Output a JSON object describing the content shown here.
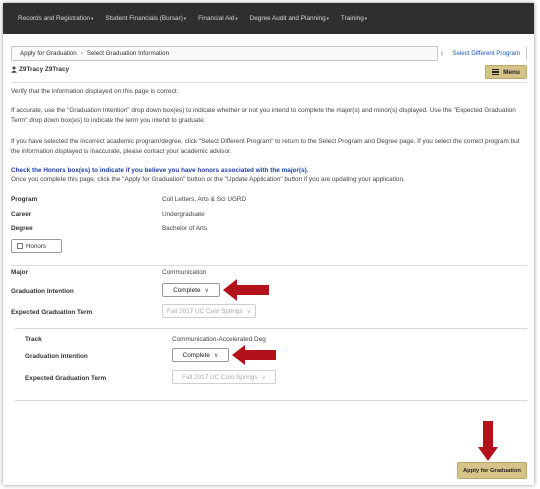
{
  "nav": {
    "items": [
      {
        "label": "Records and Registration"
      },
      {
        "label": "Student Financials (Bursar)"
      },
      {
        "label": "Financial Aid"
      },
      {
        "label": "Degree Audit and Planning"
      },
      {
        "label": "Training"
      }
    ]
  },
  "breadcrumb": {
    "apply": "Apply for Graduation",
    "separator": "›",
    "current": "Select Graduation Information",
    "select_different": "Select Different Program"
  },
  "user": {
    "name": "Z9Tracy Z9Tracy"
  },
  "menu_label": "Menu",
  "instructions": {
    "p1": "Verify that the information displayed on this page is correct.",
    "p2": "If accurate, use the \"Graduation Intention\" drop down box(es) to indicate whether or not you intend to complete the major(s) and minor(s) displayed. Use the \"Expected Graduation Term\" drop down box(es) to indicate the term you intend to graduate.",
    "p3": "If you have selected the incorrect academic program/degree, click \"Select Different Program\" to return to the Select Program and Degree page. If you select the correct program but the information displayed is inaccurate, please contact your academic advisor.",
    "honors_note": "Check the Honors box(es) to indicate if you believe you have honors associated with the major(s).",
    "p4": "Once you complete this page, click the \"Apply for Graduation\" button or the \"Update Application\" button if you are updating your application."
  },
  "program": {
    "program_label": "Program",
    "program_value": "Coll Letters, Arts & Sci UGRD",
    "career_label": "Career",
    "career_value": "Undergraduate",
    "degree_label": "Degree",
    "degree_value": "Bachelor of Arts",
    "honors_label": "Honors"
  },
  "major": {
    "major_label": "Major",
    "major_value": "Communication",
    "intention_label": "Graduation Intention",
    "intention_value": "Complete",
    "term_label": "Expected Graduation Term",
    "term_value": "Fall 2017 UC Colo Springs"
  },
  "track": {
    "track_label": "Track",
    "track_value": "Communication-Accelerated Deg",
    "intention_label": "Graduation Intention",
    "intention_value": "Complete",
    "term_label": "Expected Graduation Term",
    "term_value": "Fall 2017 UC Colo Springs"
  },
  "apply_button": "Apply for Graduation",
  "colors": {
    "nav_bg": "#2f2f2f",
    "button_gold": "#d6c387",
    "arrow_red": "#b3121b",
    "link_blue": "#1a56b4"
  },
  "icons": [
    "person-icon",
    "hamburger-icon",
    "chevron-left-icon",
    "chevron-down-icon",
    "red-arrow"
  ]
}
